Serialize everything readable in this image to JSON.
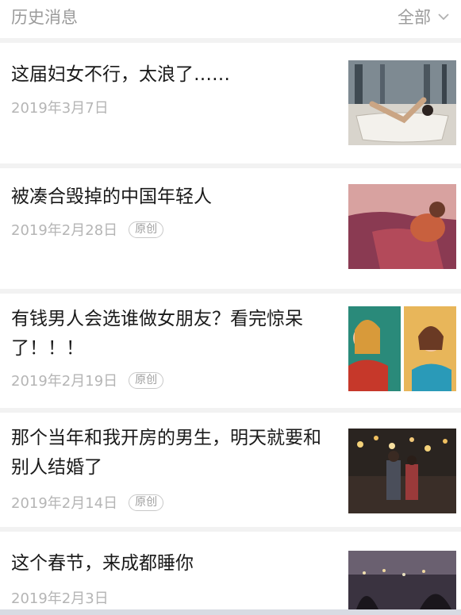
{
  "header": {
    "title": "历史消息",
    "filter_label": "全部",
    "filter_icon": "chevron-down-icon"
  },
  "articles": [
    {
      "title": "这届妇女不行，太浪了……",
      "date": "2019年3月7日",
      "badge": "",
      "thumbnail": "woman-in-bathtub-image"
    },
    {
      "title": "被凑合毁掉的中国年轻人",
      "date": "2019年2月28日",
      "badge": "原创",
      "thumbnail": "man-on-couch-illustration"
    },
    {
      "title": "有钱男人会选谁做女朋友？看完惊呆了！！！",
      "date": "2019年2月19日",
      "badge": "原创",
      "thumbnail": "two-women-illustration"
    },
    {
      "title": "那个当年和我开房的男生，明天就要和别人结婚了",
      "date": "2019年2月14日",
      "badge": "原创",
      "thumbnail": "couple-street-lights-photo"
    },
    {
      "title": "这个春节，来成都睡你",
      "date": "2019年2月3日",
      "badge": "",
      "thumbnail": "city-night-photo"
    }
  ]
}
